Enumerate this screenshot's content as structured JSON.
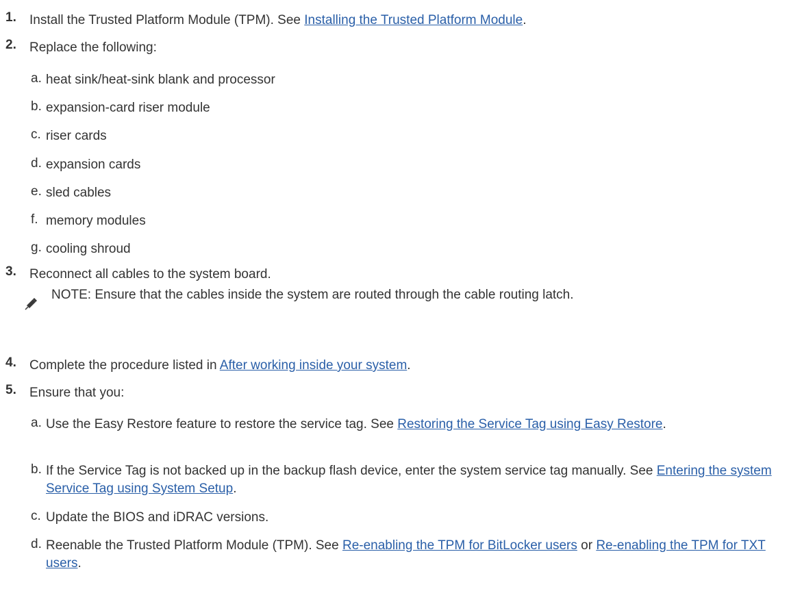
{
  "steps": [
    {
      "num": "1.",
      "before": "Install the Trusted Platform Module (TPM). See ",
      "link": "Installing the Trusted Platform Module",
      "after": "."
    },
    {
      "num": "2.",
      "text": "Replace the following:"
    },
    {
      "num": "3.",
      "text": "Reconnect all cables to the system board."
    },
    {
      "num": "4.",
      "before": "Complete the procedure listed in ",
      "link": "After working inside your system",
      "after": "."
    },
    {
      "num": "5.",
      "text": "Ensure that you:"
    }
  ],
  "replace_items": [
    {
      "letter": "a.",
      "text": "heat sink/heat-sink blank and processor"
    },
    {
      "letter": "b.",
      "text": "expansion-card riser module"
    },
    {
      "letter": "c.",
      "text": "riser cards"
    },
    {
      "letter": "d.",
      "text": "expansion cards"
    },
    {
      "letter": "e.",
      "text": "sled cables"
    },
    {
      "letter": "f.",
      "text": "memory modules"
    },
    {
      "letter": "g.",
      "text": "cooling shroud"
    }
  ],
  "note": {
    "icon": "pencil-note-icon",
    "text": "NOTE: Ensure that the cables inside the system are routed through the cable routing latch."
  },
  "ensure_items": [
    {
      "letter": "a.",
      "before": "Use the Easy Restore feature to restore the service tag. See ",
      "link": "Restoring the Service Tag using Easy Restore",
      "after": "."
    },
    {
      "letter": "b.",
      "before": "If the Service Tag is not backed up in the backup flash device, enter the system service tag manually. See ",
      "link": "Entering the system Service Tag using System Setup",
      "after": "."
    },
    {
      "letter": "c.",
      "text": "Update the BIOS and iDRAC versions."
    },
    {
      "letter": "d.",
      "before": "Reenable the Trusted Platform Module (TPM). See ",
      "link": "Re-enabling the TPM for BitLocker users",
      "middle": " or ",
      "link2": "Re-enabling the TPM for TXT users",
      "after": "."
    }
  ],
  "colors": {
    "text": "#333333",
    "link": "#2a5fa8"
  }
}
